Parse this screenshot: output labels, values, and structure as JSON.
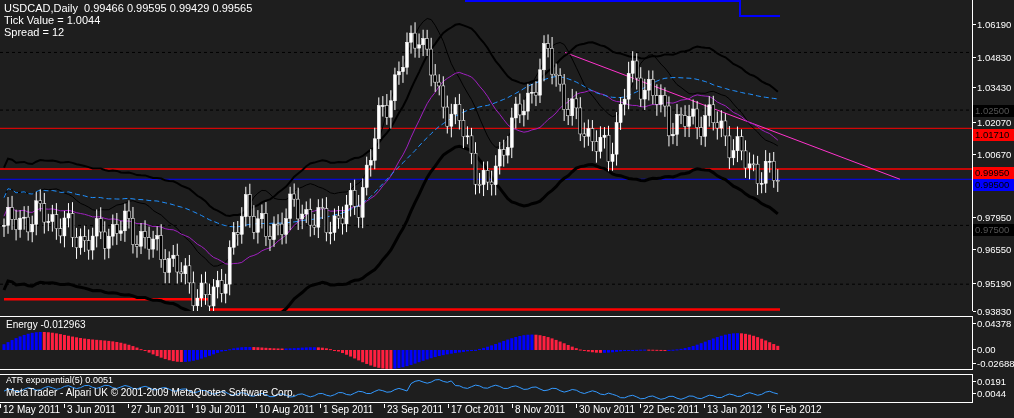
{
  "header": {
    "symbol_line": "USDCAD,Daily  0.99466 0.99595 0.99429 0.99565",
    "tick_value": "Tick Value = 1.0044",
    "spread": "Spread = 12"
  },
  "price_axis": {
    "ticks": [
      "1.06190",
      "1.04830",
      "1.03430",
      "1.02070",
      "1.00670",
      "0.97950",
      "0.96550",
      "0.95190",
      "0.93830"
    ],
    "line_labels": [
      {
        "text": "1.02500",
        "color": "#000000"
      },
      {
        "text": "1.01710",
        "color": "#ff0000"
      },
      {
        "text": "0.99950",
        "color": "#ff0000"
      },
      {
        "text": "0.99500",
        "color": "#0000ff"
      },
      {
        "text": "0.97500",
        "color": "#000000"
      }
    ]
  },
  "energy_panel": {
    "label": "Energy -0.012963",
    "ticks": [
      "0.04378",
      "0.00",
      "-0.02688"
    ]
  },
  "atr_panel": {
    "label": "ATR exponential(5) 0.0051",
    "ticks": [
      "0.0191",
      "0.0044"
    ]
  },
  "copyright": "MetaTrader - Alpari UK © 2001-2009 MetaQuotes Software Corp.",
  "time_axis": [
    "12 May 2011",
    "3 Jun 2011",
    "27 Jun 2011",
    "19 Jul 2011",
    "10 Aug 2011",
    "1 Sep 2011",
    "23 Sep 2011",
    "17 Oct 2011",
    "8 Nov 2011",
    "30 Nov 2011",
    "22 Dec 2011",
    "13 Jan 2012",
    "6 Feb 2012"
  ]
}
